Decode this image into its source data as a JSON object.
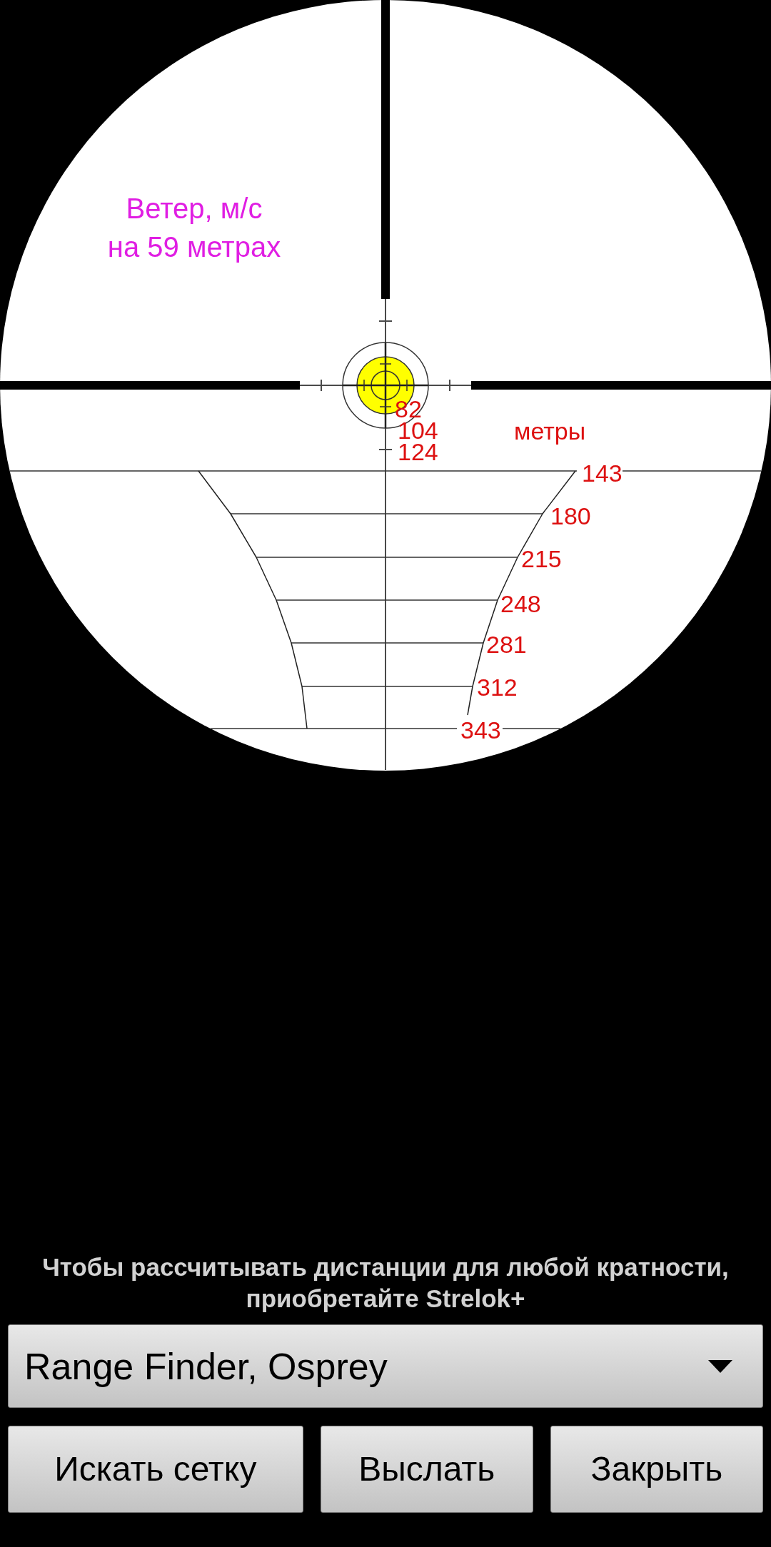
{
  "reticle": {
    "wind_note": {
      "lines": [
        "Ветер, м/с",
        "на 59 метрах"
      ]
    },
    "units_label": "метры",
    "range_marks": [
      "82",
      "104",
      "124",
      "143",
      "180",
      "215",
      "248",
      "281",
      "312",
      "343"
    ]
  },
  "notice": "Чтобы рассчитывать дистанции для любой кратности, приобретайте Strelok+",
  "reticle_select": {
    "value": "Range Finder, Osprey"
  },
  "buttons": [
    {
      "label": "Искать сетку"
    },
    {
      "label": "Выслать"
    },
    {
      "label": "Закрыть"
    }
  ]
}
